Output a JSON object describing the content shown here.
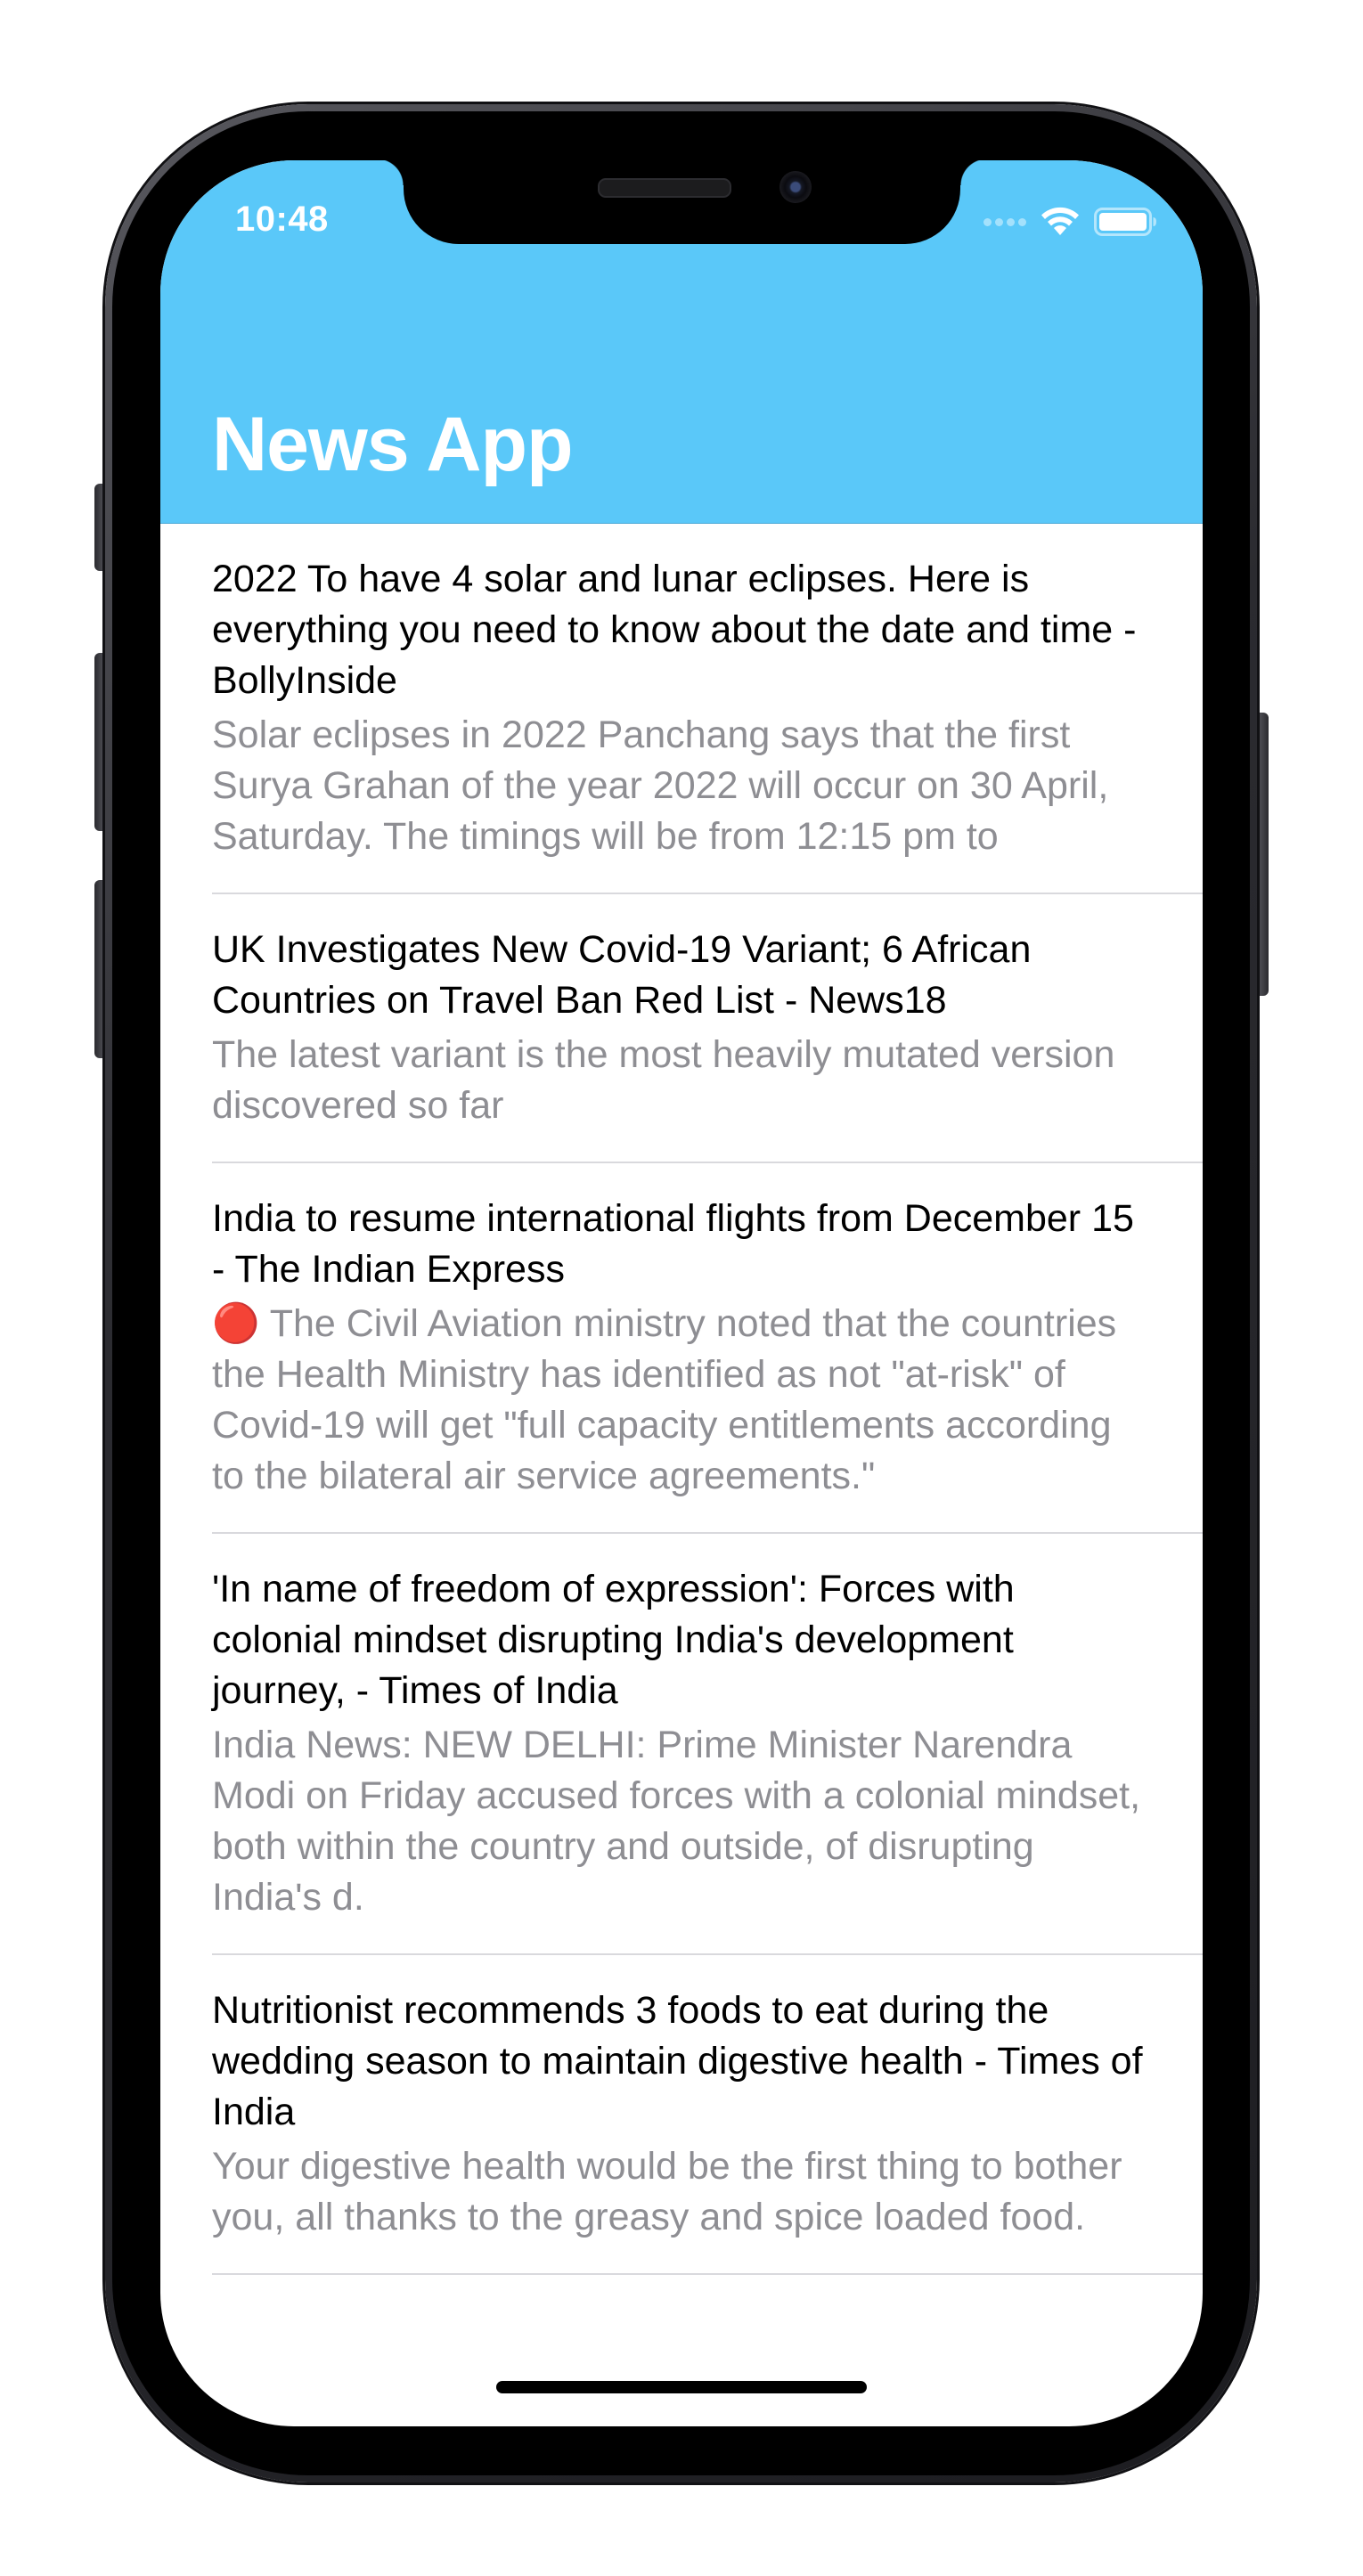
{
  "status_bar": {
    "time": "10:48",
    "wifi_icon": "wifi-icon",
    "battery_icon": "battery-icon"
  },
  "nav": {
    "title": "News App",
    "background_color": "#5ac8f9"
  },
  "articles": [
    {
      "title": "2022 To have 4 solar and lunar eclipses. Here is everything you need to know about the date and time - BollyInside",
      "description": "Solar eclipses in 2022 Panchang says that the first Surya Grahan of the year 2022 will occur on 30 April, Saturday. The timings will be from 12:15 pm to"
    },
    {
      "title": "UK Investigates New Covid-19 Variant; 6 African Countries on Travel Ban Red List - News18",
      "description": "The latest variant is the most heavily mutated version discovered so far"
    },
    {
      "title": "India to resume international flights from December 15 - The Indian Express",
      "description": "🔴 The Civil Aviation ministry noted that the countries the Health Ministry has identified as not \"at-risk\" of Covid-19 will get \"full capacity entitlements according to the bilateral air service agreements.\""
    },
    {
      "title": "'In name of freedom of expression': Forces with colonial mindset disrupting India's development journey, - Times of India",
      "description": "India News: NEW DELHI: Prime Minister Narendra Modi on Friday accused forces with a colonial mindset, both within the country and outside, of disrupting India's d."
    },
    {
      "title": "Nutritionist recommends 3 foods to eat during the wedding season to maintain digestive health - Times of India",
      "description": "Your digestive health would be the first thing to bother you, all thanks to the greasy and spice loaded food."
    }
  ]
}
